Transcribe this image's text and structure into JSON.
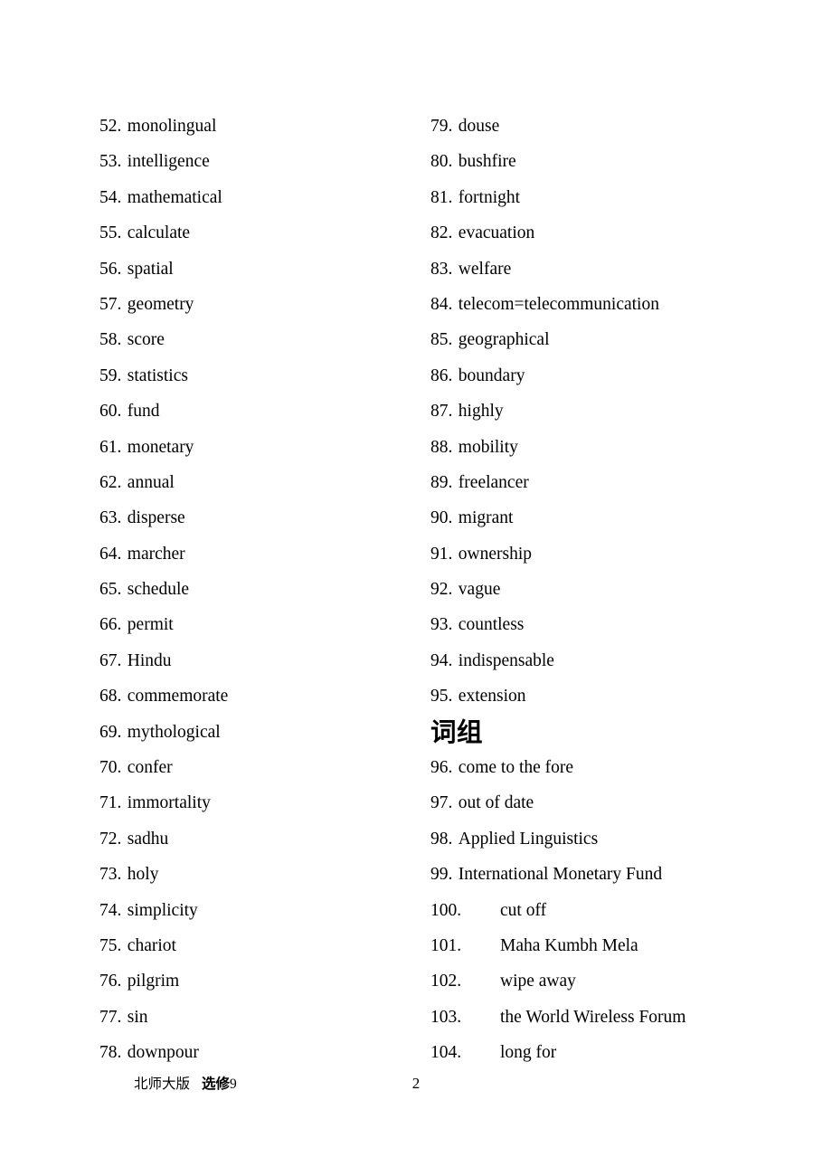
{
  "document": {
    "page_number": "2",
    "footer": {
      "publisher": "北师大版",
      "volume_label": "选修",
      "volume_number": "9"
    }
  },
  "left_column": {
    "items": [
      {
        "number": "52.",
        "term": "monolingual"
      },
      {
        "number": "53.",
        "term": "intelligence"
      },
      {
        "number": "54.",
        "term": "mathematical"
      },
      {
        "number": "55.",
        "term": "calculate"
      },
      {
        "number": "56.",
        "term": "spatial"
      },
      {
        "number": "57.",
        "term": "geometry"
      },
      {
        "number": "58.",
        "term": "score"
      },
      {
        "number": "59.",
        "term": "statistics"
      },
      {
        "number": "60.",
        "term": "fund"
      },
      {
        "number": "61.",
        "term": "monetary"
      },
      {
        "number": "62.",
        "term": "annual"
      },
      {
        "number": "63.",
        "term": "disperse"
      },
      {
        "number": "64.",
        "term": "marcher"
      },
      {
        "number": "65.",
        "term": "schedule"
      },
      {
        "number": "66.",
        "term": "permit"
      },
      {
        "number": "67.",
        "term": "Hindu"
      },
      {
        "number": "68.",
        "term": "commemorate"
      },
      {
        "number": "69.",
        "term": "mythological"
      },
      {
        "number": "70.",
        "term": "confer"
      },
      {
        "number": "71.",
        "term": "immortality"
      },
      {
        "number": "72.",
        "term": "sadhu"
      },
      {
        "number": "73.",
        "term": "holy"
      },
      {
        "number": "74.",
        "term": "simplicity"
      },
      {
        "number": "75.",
        "term": "chariot"
      },
      {
        "number": "76.",
        "term": "pilgrim"
      },
      {
        "number": "77.",
        "term": "sin"
      },
      {
        "number": "78.",
        "term": "downpour"
      }
    ]
  },
  "right_column": {
    "words": [
      {
        "number": "79.",
        "term": "douse"
      },
      {
        "number": "80.",
        "term": "bushfire"
      },
      {
        "number": "81.",
        "term": "fortnight"
      },
      {
        "number": "82.",
        "term": "evacuation"
      },
      {
        "number": "83.",
        "term": "welfare"
      },
      {
        "number": "84.",
        "term": "telecom=telecommunication"
      },
      {
        "number": "85.",
        "term": "geographical"
      },
      {
        "number": "86.",
        "term": "boundary"
      },
      {
        "number": "87.",
        "term": "highly"
      },
      {
        "number": "88.",
        "term": "mobility"
      },
      {
        "number": "89.",
        "term": "freelancer"
      },
      {
        "number": "90.",
        "term": "migrant"
      },
      {
        "number": "91.",
        "term": "ownership"
      },
      {
        "number": "92.",
        "term": "vague"
      },
      {
        "number": "93.",
        "term": "countless"
      },
      {
        "number": "94.",
        "term": "indispensable"
      },
      {
        "number": "95.",
        "term": "extension"
      }
    ],
    "section_heading": "词组",
    "phrases": [
      {
        "number": "96.",
        "term": "come to the fore",
        "wide": false
      },
      {
        "number": "97.",
        "term": "out of date",
        "wide": false
      },
      {
        "number": "98.",
        "term": "Applied Linguistics",
        "wide": false
      },
      {
        "number": "99.",
        "term": "International Monetary Fund",
        "wide": false
      },
      {
        "number": "100.",
        "term": "cut off",
        "wide": true
      },
      {
        "number": "101.",
        "term": "Maha Kumbh Mela",
        "wide": true
      },
      {
        "number": "102.",
        "term": "wipe away",
        "wide": true
      },
      {
        "number": "103.",
        "term": "the World Wireless Forum",
        "wide": true
      },
      {
        "number": "104.",
        "term": "long for",
        "wide": true
      }
    ]
  }
}
